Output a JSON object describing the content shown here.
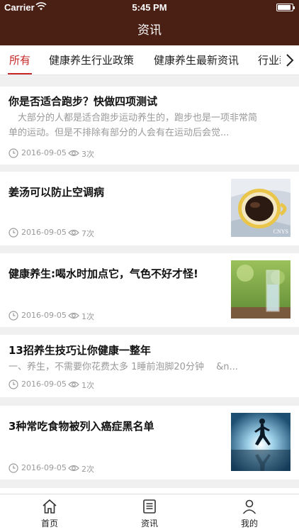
{
  "status_bar": {
    "carrier": "Carrier",
    "time": "5:45 PM",
    "battery_level": 0.9
  },
  "nav": {
    "title": "资讯"
  },
  "tabs": [
    {
      "label": "所有",
      "active": true
    },
    {
      "label": "健康养生行业政策",
      "active": false
    },
    {
      "label": "健康养生最新资讯",
      "active": false
    },
    {
      "label": "行业新",
      "active": false
    }
  ],
  "tab_more_icon": "chevron-right-icon",
  "articles": [
    {
      "title": "你是否适合跑步？快做四项测试",
      "summary_line1": "　大部分的人都是适合跑步运动养生的，跑步也是一项非常简",
      "summary_line2": "单的运动。但是不排除有部分的人会有在运动后会觉...",
      "date": "2016-09-05",
      "views": "3次"
    },
    {
      "title": "姜汤可以防止空调病",
      "date": "2016-09-05",
      "views": "7次",
      "thumb_caption": "CNYS"
    },
    {
      "title": "健康养生:喝水时加点它，气色不好才怪!",
      "date": "2016-09-05",
      "views": "1次"
    },
    {
      "title": "13招养生技巧让你健康一整年",
      "summary": "一、养生，不需要你花费太多 1睡前泡脚20分钟　 &n...",
      "date": "2016-09-05",
      "views": "1次"
    },
    {
      "title": "3种常吃食物被列入癌症黑名单",
      "date": "2016-09-05",
      "views": "2次"
    }
  ],
  "tabbar": [
    {
      "label": "首页",
      "icon": "home-icon"
    },
    {
      "label": "资讯",
      "icon": "news-icon"
    },
    {
      "label": "我的",
      "icon": "user-icon"
    }
  ],
  "colors": {
    "brand": "#4a1f14",
    "accent": "#c62828",
    "muted": "#9a9a9a"
  }
}
